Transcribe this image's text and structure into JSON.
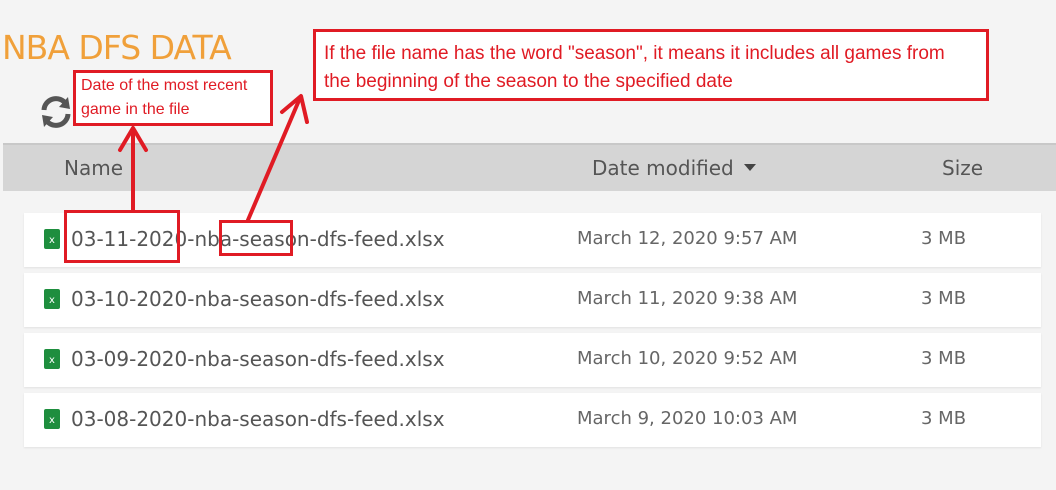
{
  "page": {
    "title": "NBA DFS DATA"
  },
  "columns": {
    "name": "Name",
    "date_modified": "Date modified",
    "size": "Size"
  },
  "files": [
    {
      "name": "03-11-2020-nba-season-dfs-feed.xlsx",
      "date": "March 12, 2020 9:57 AM",
      "size": "3 MB"
    },
    {
      "name": "03-10-2020-nba-season-dfs-feed.xlsx",
      "date": "March 11, 2020 9:38 AM",
      "size": "3 MB"
    },
    {
      "name": "03-09-2020-nba-season-dfs-feed.xlsx",
      "date": "March 10, 2020 9:52 AM",
      "size": "3 MB"
    },
    {
      "name": "03-08-2020-nba-season-dfs-feed.xlsx",
      "date": "March 9, 2020 10:03 AM",
      "size": "3 MB"
    }
  ],
  "annotations": {
    "date_note": "Date of the most recent game in the file",
    "season_note": "If the file name has the word \"season\", it means it includes all games from the beginning of the season to the specified date"
  },
  "colors": {
    "title": "#f0a03a",
    "annotation": "#e01b24",
    "excel_icon": "#1e8e3e"
  }
}
